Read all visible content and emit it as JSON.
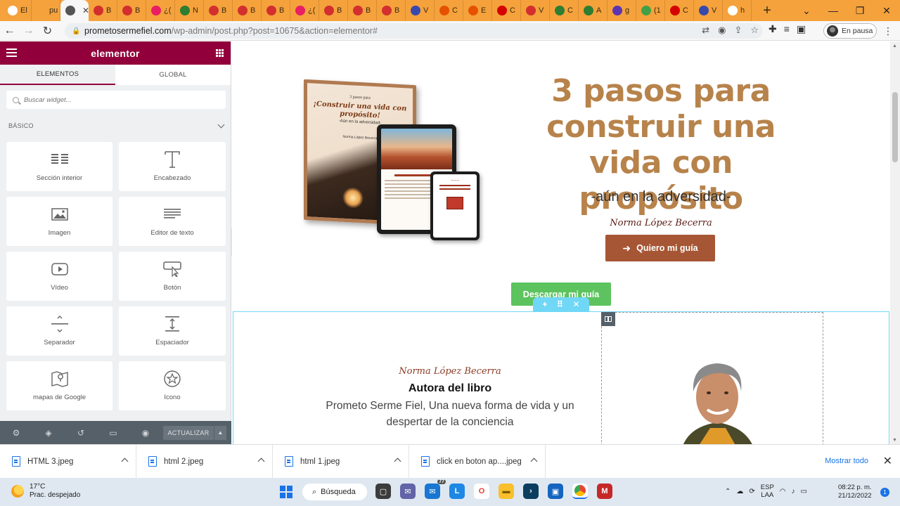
{
  "browser": {
    "tabs": [
      {
        "label": "El",
        "color": "#ffffff"
      },
      {
        "label": "pu",
        "color": "#f5a23c"
      },
      {
        "label": "",
        "color": "#555555",
        "active": true
      },
      {
        "label": "B",
        "color": "#d32f2f"
      },
      {
        "label": "B",
        "color": "#d32f2f"
      },
      {
        "label": "¿(",
        "color": "#e91e63"
      },
      {
        "label": "N",
        "color": "#2e7d32"
      },
      {
        "label": "B",
        "color": "#d32f2f"
      },
      {
        "label": "B",
        "color": "#d32f2f"
      },
      {
        "label": "B",
        "color": "#d32f2f"
      },
      {
        "label": "¿(",
        "color": "#e91e63"
      },
      {
        "label": "B",
        "color": "#d32f2f"
      },
      {
        "label": "B",
        "color": "#d32f2f"
      },
      {
        "label": "B",
        "color": "#d32f2f"
      },
      {
        "label": "V",
        "color": "#3949ab"
      },
      {
        "label": "C",
        "color": "#e65100"
      },
      {
        "label": "E",
        "color": "#e65100"
      },
      {
        "label": "C",
        "color": "#d50000"
      },
      {
        "label": "V",
        "color": "#d32f2f"
      },
      {
        "label": "C",
        "color": "#2e7d32"
      },
      {
        "label": "A",
        "color": "#2e7d32"
      },
      {
        "label": "g",
        "color": "#5e35b1"
      },
      {
        "label": "(1",
        "color": "#43a047"
      },
      {
        "label": "C",
        "color": "#d50000"
      },
      {
        "label": "V",
        "color": "#3949ab"
      },
      {
        "label": "h",
        "color": "#ffffff"
      }
    ],
    "new_tab": "+",
    "url_domain": "prometosermefiel.com",
    "url_path": "/wp-admin/post.php?post=10675&action=elementor#",
    "profile_label": "En pausa"
  },
  "panel": {
    "logo": "elementor",
    "tabs": [
      "ELEMENTOS",
      "GLOBAL"
    ],
    "search_placeholder": "Buscar widget...",
    "category": "BÁSICO",
    "widgets": [
      {
        "label": "Sección interior",
        "icon": "columns-icon"
      },
      {
        "label": "Encabezado",
        "icon": "heading-icon"
      },
      {
        "label": "Imagen",
        "icon": "image-icon"
      },
      {
        "label": "Editor de texto",
        "icon": "text-editor-icon"
      },
      {
        "label": "Vídeo",
        "icon": "video-icon"
      },
      {
        "label": "Botón",
        "icon": "button-icon"
      },
      {
        "label": "Separador",
        "icon": "divider-icon"
      },
      {
        "label": "Espaciador",
        "icon": "spacer-icon"
      },
      {
        "label": "mapas de Google",
        "icon": "map-icon"
      },
      {
        "label": "Icono",
        "icon": "star-icon"
      }
    ],
    "update_label": "ACTUALIZAR"
  },
  "canvas": {
    "book": {
      "top_text": "3 pasos para",
      "title": "¡Construir una vida con propósito!",
      "subtitle": "-Aún en la adversidad-",
      "author": "Norma López Becerra"
    },
    "hero_title": "3 pasos para construir una vida con propósito",
    "hero_subtitle": "-aún en la adversidad-",
    "hero_author": "Norma López Becerra",
    "cta_label": "Quiero mi guía",
    "download_label": "Descargar mi guía",
    "author_name": "Norma López Becerra",
    "author_role": "Autora del libro",
    "author_desc": "Prometo Serme Fiel, Una nueva forma de vida y un despertar de la conciencia"
  },
  "downloads": {
    "items": [
      "HTML 3.jpeg",
      "html 2.jpeg",
      "html 1.jpeg",
      "click en boton ap....jpeg"
    ],
    "show_all": "Mostrar todo"
  },
  "taskbar": {
    "temp": "17°C",
    "weather": "Prac. despejado",
    "search": "Búsqueda",
    "lang_1": "ESP",
    "lang_2": "LAA",
    "time": "08:22 p. m.",
    "date": "21/12/2022",
    "notifications": "1",
    "mail_badge": "77"
  },
  "colors": {
    "elementor_brand": "#92003b",
    "heading_gold": "#b7834b",
    "cta_brown": "#a65634",
    "download_green": "#5cc35e",
    "selection_blue": "#71d7f7"
  }
}
